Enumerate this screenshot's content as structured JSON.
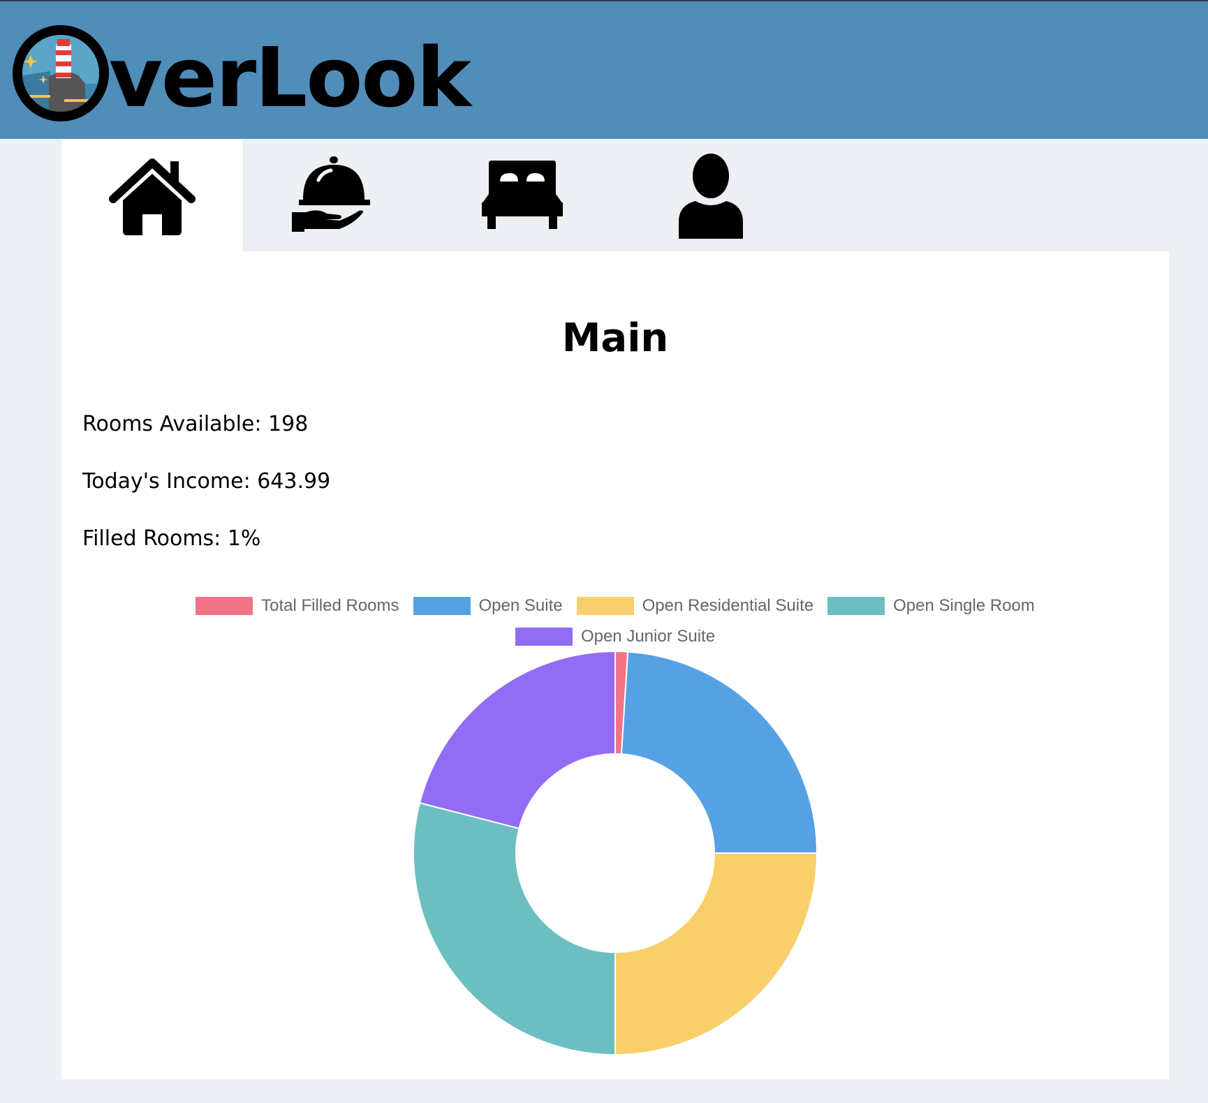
{
  "header": {
    "logo_text": "verLook",
    "brand_name": "OverLook"
  },
  "nav": {
    "tabs": [
      {
        "name": "home",
        "icon": "home-icon",
        "active": true
      },
      {
        "name": "room-service",
        "icon": "serving-tray-icon",
        "active": false
      },
      {
        "name": "rooms",
        "icon": "bed-icon",
        "active": false
      },
      {
        "name": "customer",
        "icon": "user-icon",
        "active": false
      }
    ]
  },
  "main": {
    "title": "Main",
    "rooms_available": "Rooms Available: 198",
    "todays_income": "Today's Income: 643.99",
    "filled_rooms": "Filled Rooms: 1%"
  },
  "colors": {
    "header": "#508db9",
    "background": "#eceff3"
  },
  "chart_data": {
    "type": "pie",
    "donut": true,
    "legend_position": "top",
    "categories": [
      "Total Filled Rooms",
      "Open Suite",
      "Open Residential Suite",
      "Open Single Room",
      "Open Junior Suite"
    ],
    "values": [
      2,
      48,
      50,
      58,
      42
    ],
    "colors": [
      "#f07386",
      "#56a1e4",
      "#f8cf6b",
      "#6cbfc0",
      "#926cf5"
    ]
  }
}
